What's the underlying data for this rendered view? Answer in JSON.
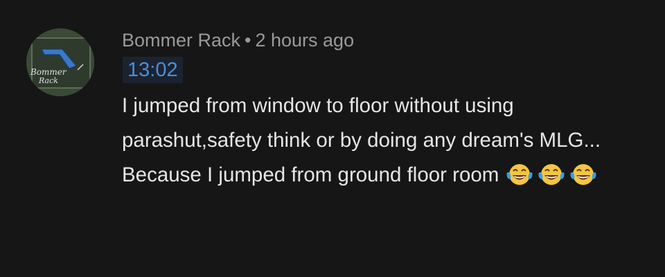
{
  "comment": {
    "author": "Bommer Rack",
    "separator": "•",
    "time_ago": "2 hours ago",
    "timestamp_link": "13:02",
    "text": "I jumped from window to floor without using parashut,safety think or by doing any dream's MLG... Because I jumped from ground floor room",
    "emojis": [
      "face-with-tears-of-joy",
      "face-with-tears-of-joy",
      "face-with-tears-of-joy"
    ],
    "avatar": {
      "lines": [
        "Bommer",
        "Rack"
      ],
      "icon": "boomerang-icon"
    }
  },
  "colors": {
    "background": "#161616",
    "meta_text": "#9a9a9a",
    "body_text": "#e6e6e6",
    "link": "#4a8fd6"
  }
}
